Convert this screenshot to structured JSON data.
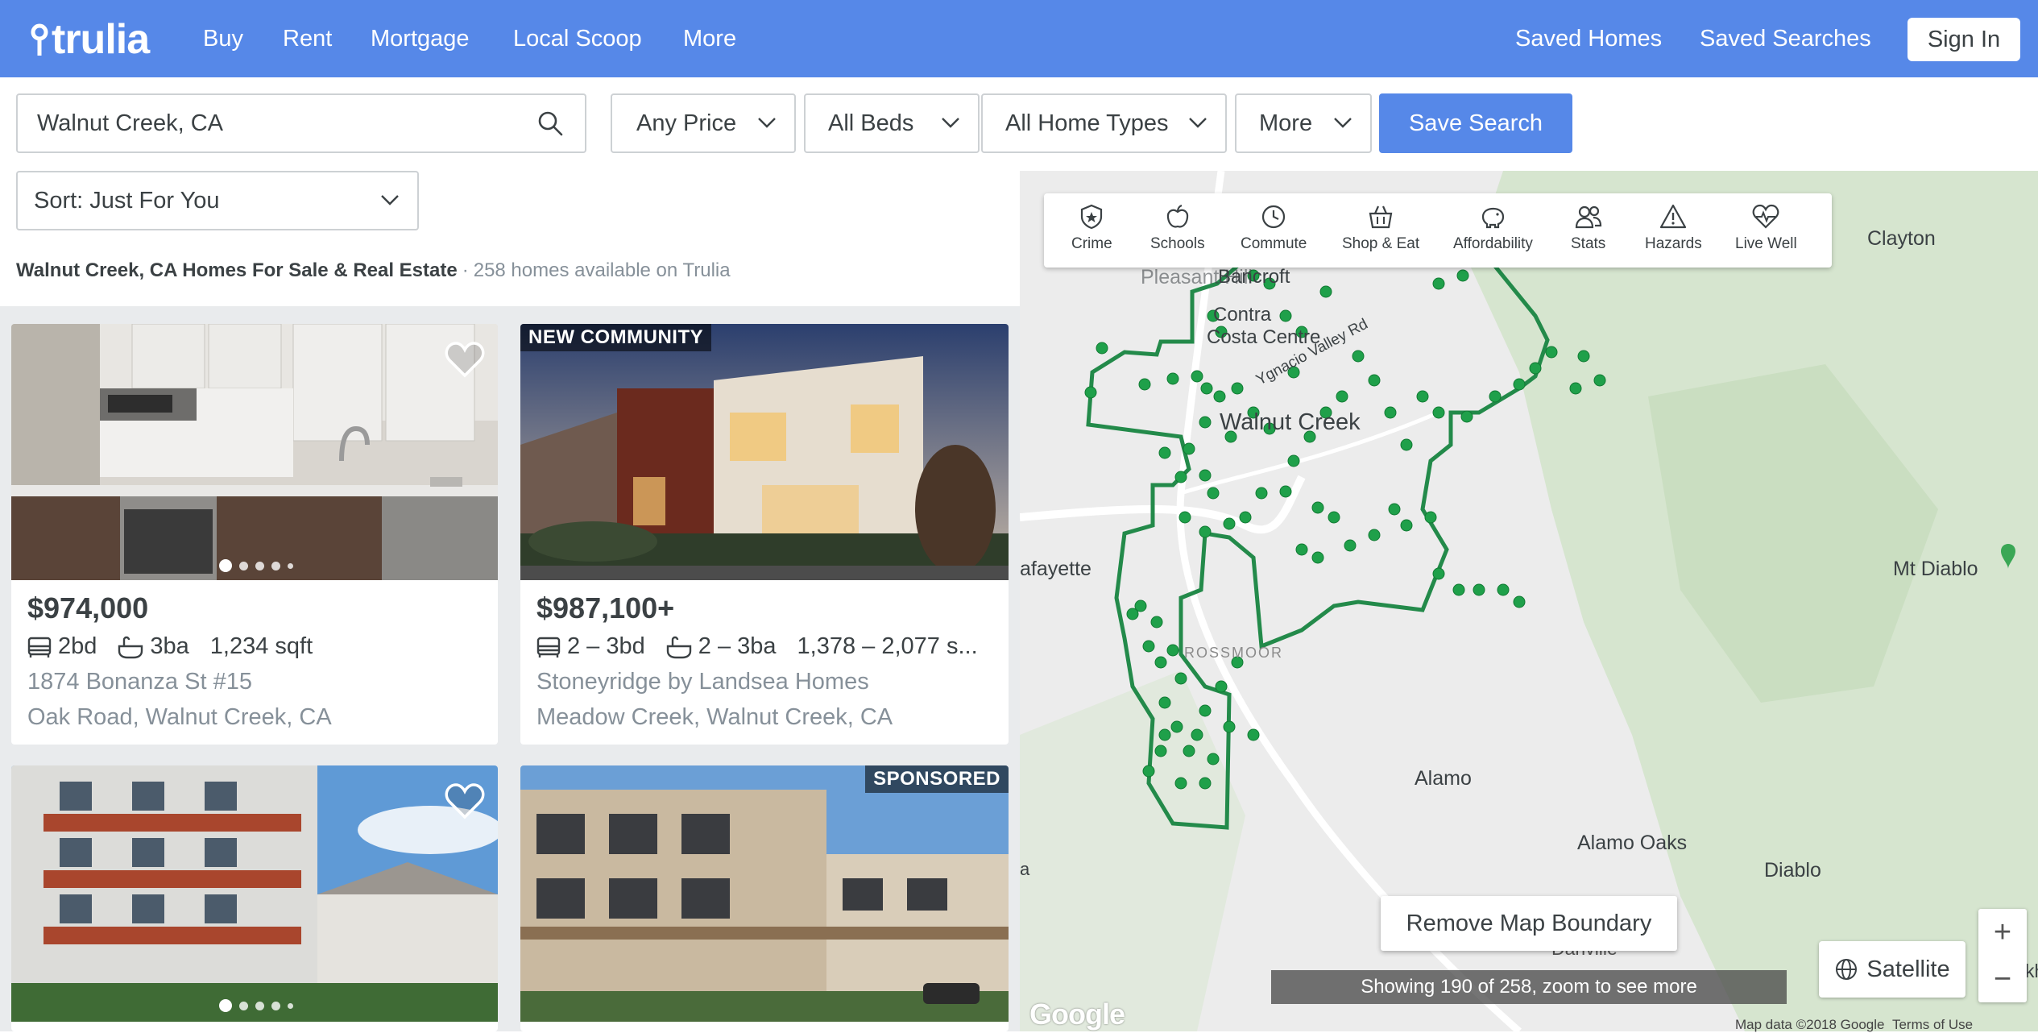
{
  "brand": {
    "name": "trulia",
    "color": "#5688e8"
  },
  "nav": {
    "links": [
      "Buy",
      "Rent",
      "Mortgage",
      "Local Scoop",
      "More"
    ],
    "saved_homes": "Saved Homes",
    "saved_searches": "Saved Searches",
    "sign_in": "Sign In"
  },
  "search": {
    "value": "Walnut Creek, CA",
    "icon": "search-icon"
  },
  "filters": {
    "price": "Any Price",
    "beds": "All Beds",
    "home_types": "All Home Types",
    "more": "More",
    "save_search": "Save Search",
    "sort": "Sort: Just For You"
  },
  "results": {
    "title": "Walnut Creek, CA Homes For Sale & Real Estate",
    "separator": "·",
    "count": "258 homes available on Trulia"
  },
  "listings": [
    {
      "price": "$974,000",
      "beds": "2bd",
      "baths": "3ba",
      "sqft": "1,234 sqft",
      "address": "1874 Bonanza St #15",
      "location": "Oak Road, Walnut Creek, CA",
      "favorite_icon": "heart-icon",
      "photo_count": 5,
      "current_photo": 1
    },
    {
      "badge": "NEW COMMUNITY",
      "price": "$987,100+",
      "beds": "2 – 3bd",
      "baths": "2 – 3ba",
      "sqft": "1,378 – 2,077 s...",
      "address": "Stoneyridge by Landsea Homes",
      "location": "Meadow Creek, Walnut Creek, CA"
    },
    {
      "favorite_icon": "heart-icon",
      "photo_count": 5,
      "current_photo": 1
    },
    {
      "badge": "SPONSORED"
    }
  ],
  "map": {
    "tools": [
      {
        "label": "Crime",
        "icon": "badge-icon"
      },
      {
        "label": "Schools",
        "icon": "apple-icon"
      },
      {
        "label": "Commute",
        "icon": "clock-icon"
      },
      {
        "label": "Shop & Eat",
        "icon": "basket-icon"
      },
      {
        "label": "Affordability",
        "icon": "piggy-bank-icon"
      },
      {
        "label": "Stats",
        "icon": "people-icon"
      },
      {
        "label": "Hazards",
        "icon": "warning-icon"
      },
      {
        "label": "Live Well",
        "icon": "heart-pulse-icon"
      }
    ],
    "labels": {
      "walnut_creek": "Walnut Creek",
      "clayton": "Clayton",
      "lafayette": "afayette",
      "mt_diablo": "Mt Diablo",
      "alamo": "Alamo",
      "alamo_oaks": "Alamo Oaks",
      "diablo": "Diablo",
      "danville": "Danville",
      "bancroft": "Bancroft",
      "contra_costa_centre_1": "Contra",
      "contra_costa_centre_2": "Costa Centre",
      "ygnacio": "Ygnacio Valley Rd",
      "rossmoor": "ROSSMOOR",
      "pleasant_hill": "Pleasant Hill",
      "edge_a": "a",
      "edge_kh": "kh"
    },
    "remove_boundary": "Remove Map Boundary",
    "showing": "Showing 190 of 258, zoom to see more",
    "satellite": "Satellite",
    "zoom_in": "+",
    "zoom_out": "−",
    "google": "Google",
    "map_data": "Map data ©2018 Google",
    "terms": "Terms of Use",
    "marker_color": "#1fa04a",
    "boundary_color": "#238a4a"
  }
}
